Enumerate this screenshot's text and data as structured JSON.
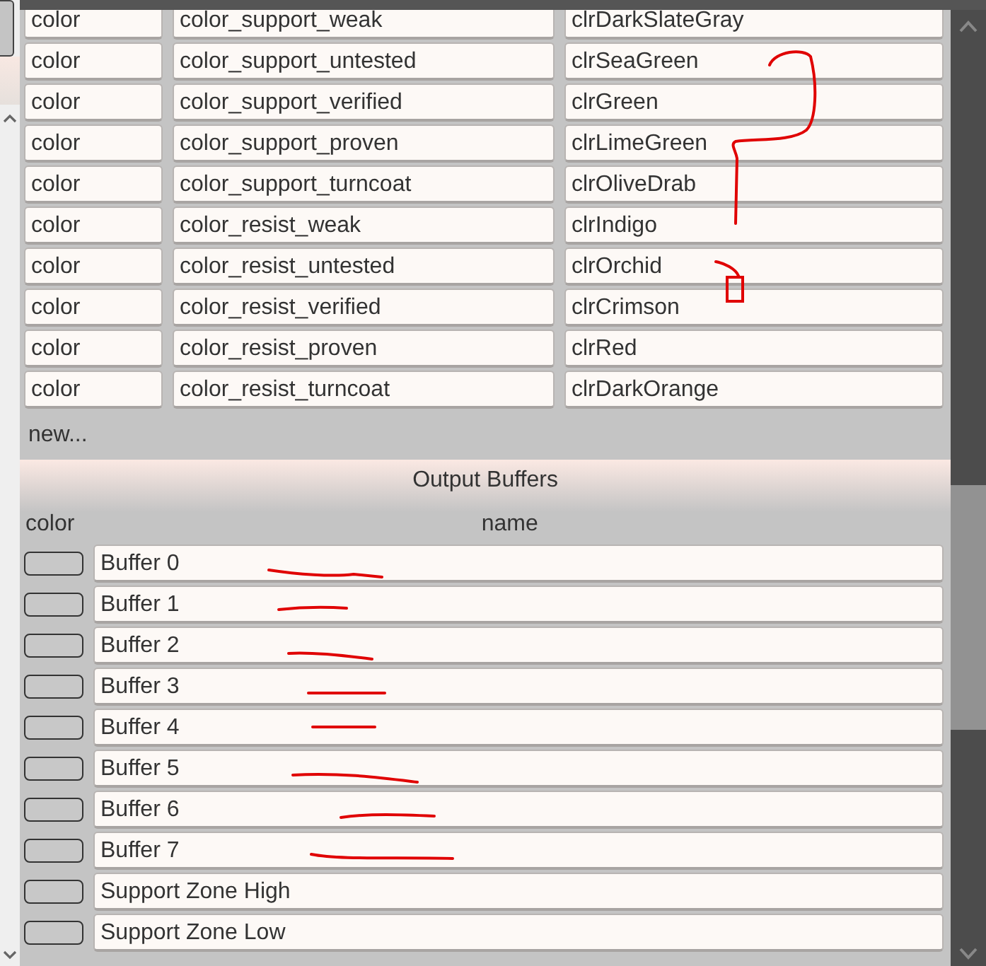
{
  "properties": {
    "rows": [
      {
        "cells": [
          "color",
          "color_support_weak",
          "clrDarkSlateGray"
        ]
      },
      {
        "cells": [
          "color",
          "color_support_untested",
          "clrSeaGreen"
        ]
      },
      {
        "cells": [
          "color",
          "color_support_verified",
          "clrGreen"
        ]
      },
      {
        "cells": [
          "color",
          "color_support_proven",
          "clrLimeGreen"
        ]
      },
      {
        "cells": [
          "color",
          "color_support_turncoat",
          "clrOliveDrab"
        ]
      },
      {
        "cells": [
          "color",
          "color_resist_weak",
          "clrIndigo"
        ]
      },
      {
        "cells": [
          "color",
          "color_resist_untested",
          "clrOrchid"
        ]
      },
      {
        "cells": [
          "color",
          "color_resist_verified",
          "clrCrimson"
        ]
      },
      {
        "cells": [
          "color",
          "color_resist_proven",
          "clrRed"
        ]
      },
      {
        "cells": [
          "color",
          "color_resist_turncoat",
          "clrDarkOrange"
        ]
      }
    ],
    "new_link": "new..."
  },
  "output_buffers": {
    "title": "Output Buffers",
    "columns": [
      "color",
      "name"
    ],
    "rows": [
      {
        "name": "Buffer 0"
      },
      {
        "name": "Buffer 1"
      },
      {
        "name": "Buffer 2"
      },
      {
        "name": "Buffer 3"
      },
      {
        "name": "Buffer 4"
      },
      {
        "name": "Buffer 5"
      },
      {
        "name": "Buffer 6"
      },
      {
        "name": "Buffer 7"
      },
      {
        "name": "Support Zone High"
      },
      {
        "name": "Support Zone Low"
      }
    ]
  }
}
